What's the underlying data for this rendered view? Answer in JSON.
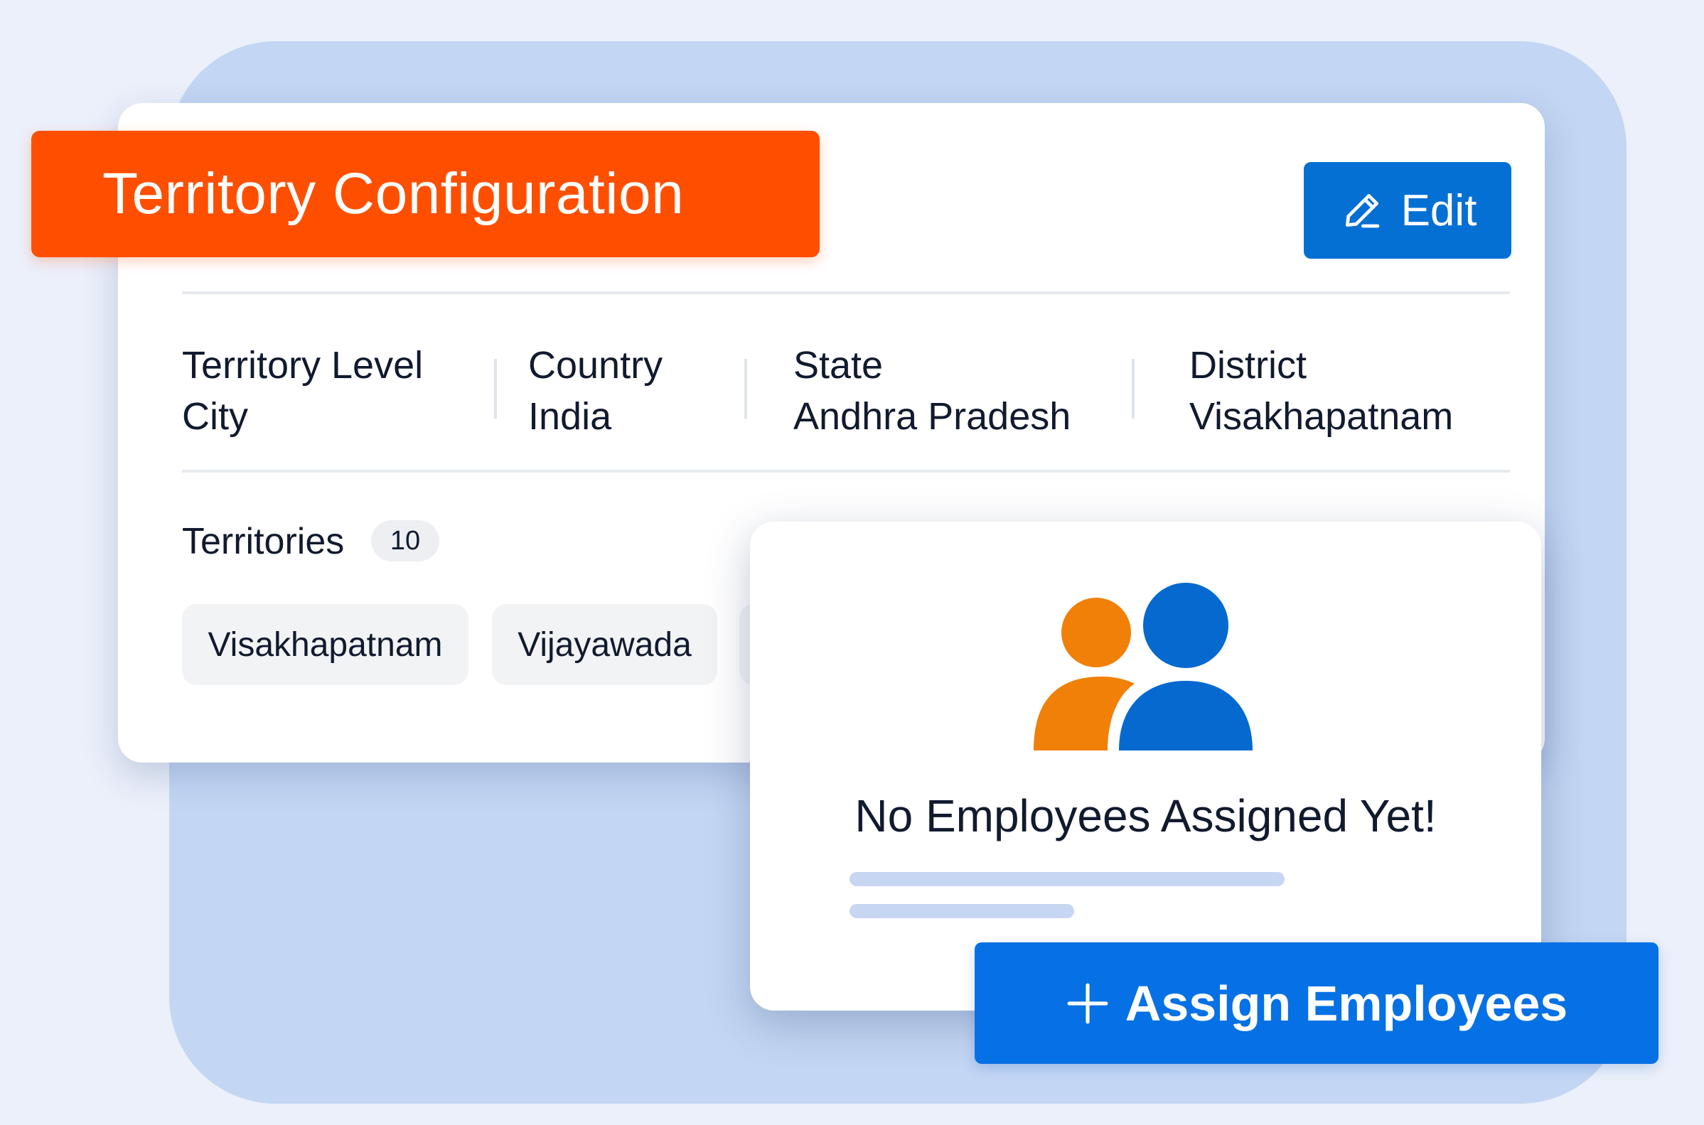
{
  "config_card": {
    "title": "Territory Configuration",
    "edit_label": "Edit",
    "fields": [
      {
        "key": "Territory Level",
        "value": "City"
      },
      {
        "key": "Country",
        "value": "India"
      },
      {
        "key": "State",
        "value": "Andhra Pradesh"
      },
      {
        "key": "District",
        "value": "Visakhapatnam"
      }
    ],
    "territories_label": "Territories",
    "territories_count": "10",
    "chips": [
      "Visakhapatnam",
      "Vijayawada"
    ]
  },
  "empty_state": {
    "title": "No Employees Assigned Yet!",
    "assign_label": "Assign Employees"
  },
  "colors": {
    "title_banner": "#fe4f00",
    "primary_blue": "#0671e4",
    "person_orange": "#f08008",
    "person_blue": "#0569cf",
    "backdrop": "#c3d6f3"
  },
  "icons": {
    "edit": "pencil-icon",
    "people": "users-icon",
    "assign": "plus-icon"
  }
}
